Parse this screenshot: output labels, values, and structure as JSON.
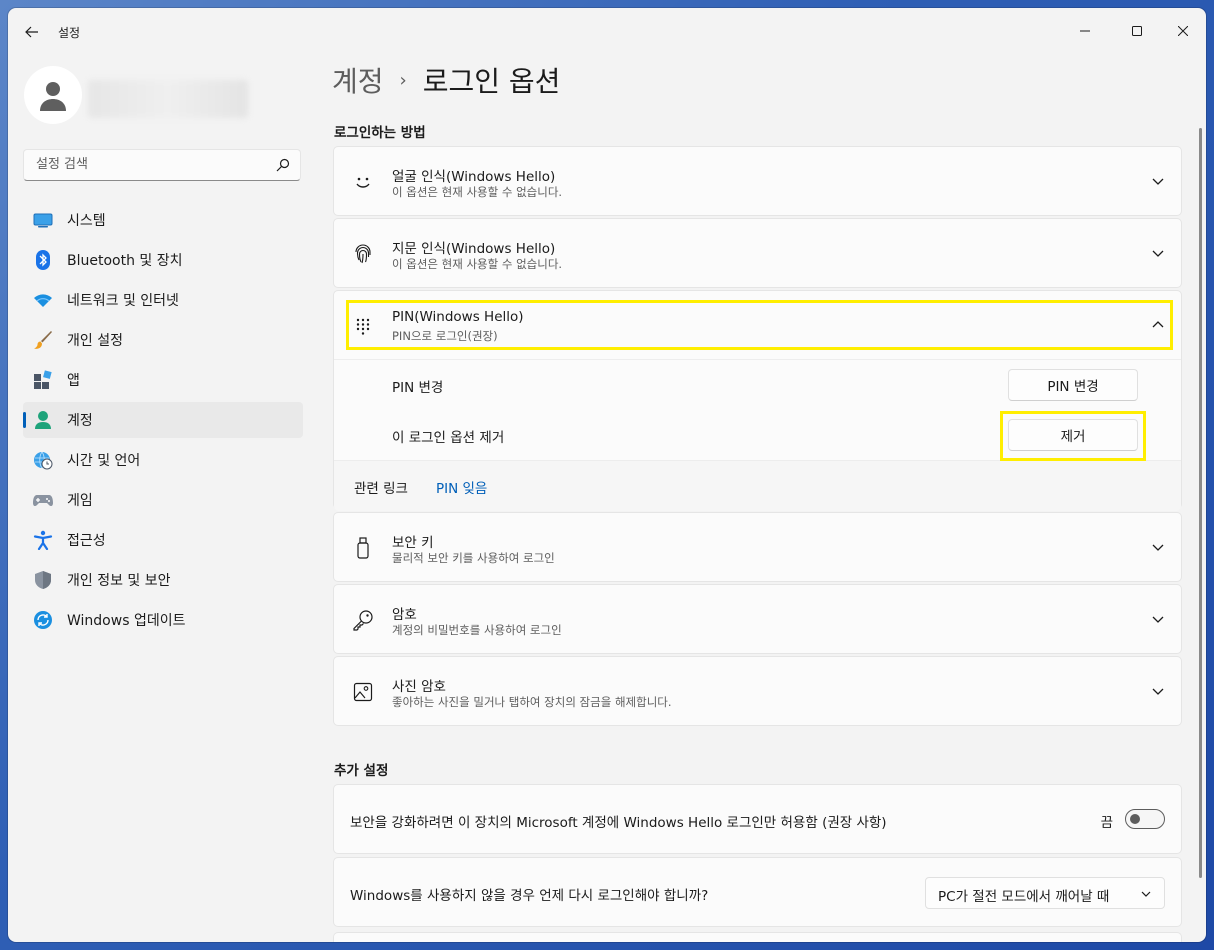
{
  "app": {
    "title": "설정"
  },
  "search": {
    "placeholder": "설정 검색"
  },
  "sidebar": {
    "items": [
      {
        "label": "시스템",
        "icon": "display-icon"
      },
      {
        "label": "Bluetooth 및 장치",
        "icon": "bluetooth-icon"
      },
      {
        "label": "네트워크 및 인터넷",
        "icon": "wifi-icon"
      },
      {
        "label": "개인 설정",
        "icon": "brush-icon"
      },
      {
        "label": "앱",
        "icon": "apps-icon"
      },
      {
        "label": "계정",
        "icon": "account-icon",
        "active": true
      },
      {
        "label": "시간 및 언어",
        "icon": "globe-clock-icon"
      },
      {
        "label": "게임",
        "icon": "gamepad-icon"
      },
      {
        "label": "접근성",
        "icon": "accessibility-icon"
      },
      {
        "label": "개인 정보 및 보안",
        "icon": "shield-icon"
      },
      {
        "label": "Windows 업데이트",
        "icon": "update-icon"
      }
    ]
  },
  "breadcrumb": {
    "parent": "계정",
    "separator": "›",
    "current": "로그인 옵션"
  },
  "signin": {
    "section_title": "로그인하는 방법",
    "face": {
      "title": "얼굴 인식(Windows Hello)",
      "subtitle": "이 옵션은 현재 사용할 수 없습니다."
    },
    "fingerprint": {
      "title": "지문 인식(Windows Hello)",
      "subtitle": "이 옵션은 현재 사용할 수 없습니다."
    },
    "pin": {
      "title": "PIN(Windows Hello)",
      "subtitle": "PIN으로 로그인(권장)",
      "change_label": "PIN 변경",
      "change_button": "PIN 변경",
      "remove_label": "이 로그인 옵션 제거",
      "remove_button": "제거",
      "related_label": "관련 링크",
      "related_link": "PIN 잊음"
    },
    "security_key": {
      "title": "보안 키",
      "subtitle": "물리적 보안 키를 사용하여 로그인"
    },
    "password": {
      "title": "암호",
      "subtitle": "계정의 비밀번호를 사용하여 로그인"
    },
    "picture_password": {
      "title": "사진 암호",
      "subtitle": "좋아하는 사진을 밀거나 탭하여 장치의 잠금을 해제합니다."
    }
  },
  "additional": {
    "section_title": "추가 설정",
    "hello_only": {
      "label": "보안을 강화하려면 이 장치의 Microsoft 계정에 Windows Hello 로그인만 허용함 (권장 사항)",
      "state": "끔",
      "on": false
    },
    "require_signin": {
      "label": "Windows를 사용하지 않을 경우 언제 다시 로그인해야 합니까?",
      "value": "PC가 절전 모드에서 깨어날 때"
    }
  },
  "colors": {
    "accent": "#005fb8",
    "highlight": "#ffee00"
  }
}
